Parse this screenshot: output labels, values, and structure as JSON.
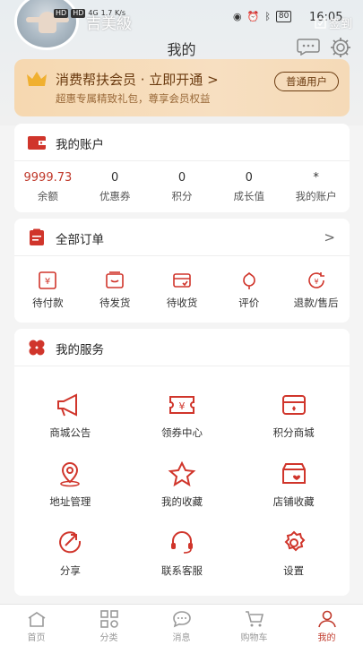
{
  "status_bar": {
    "sim1": "HD",
    "sim2": "HD",
    "net": "4G",
    "speed": "1.7 K/s",
    "battery": "80",
    "time": "16:05"
  },
  "header": {
    "username": "吉美級",
    "signin": "签到",
    "title": "我的"
  },
  "vip": {
    "title": "消费帮扶会员 · 立即开通 >",
    "subtitle": "超惠专属精致礼包，尊享会员权益",
    "badge": "普通用户"
  },
  "account": {
    "title": "我的账户",
    "items": [
      {
        "value": "9999.73",
        "label": "余额"
      },
      {
        "value": "0",
        "label": "优惠券"
      },
      {
        "value": "0",
        "label": "积分"
      },
      {
        "value": "0",
        "label": "成长值"
      },
      {
        "value": "*",
        "label": "我的账户"
      }
    ]
  },
  "orders": {
    "title": "全部订单",
    "arrow": ">",
    "items": [
      {
        "label": "待付款",
        "icon": "wallet-yen-icon"
      },
      {
        "label": "待发货",
        "icon": "box-icon"
      },
      {
        "label": "待收货",
        "icon": "receipt-icon"
      },
      {
        "label": "评价",
        "icon": "flower-icon"
      },
      {
        "label": "退款/售后",
        "icon": "refund-icon"
      }
    ]
  },
  "services": {
    "title": "我的服务",
    "items": [
      {
        "label": "商城公告",
        "icon": "megaphone-icon"
      },
      {
        "label": "领券中心",
        "icon": "coupon-icon"
      },
      {
        "label": "积分商城",
        "icon": "points-mall-icon"
      },
      {
        "label": "地址管理",
        "icon": "location-icon"
      },
      {
        "label": "我的收藏",
        "icon": "star-icon"
      },
      {
        "label": "店铺收藏",
        "icon": "store-heart-icon"
      },
      {
        "label": "分享",
        "icon": "share-icon"
      },
      {
        "label": "联系客服",
        "icon": "headset-icon"
      },
      {
        "label": "设置",
        "icon": "settings-icon"
      }
    ]
  },
  "tabbar": {
    "items": [
      {
        "label": "首页",
        "icon": "home-icon"
      },
      {
        "label": "分类",
        "icon": "category-icon"
      },
      {
        "label": "消息",
        "icon": "message-icon"
      },
      {
        "label": "购物车",
        "icon": "cart-icon"
      },
      {
        "label": "我的",
        "icon": "user-icon"
      }
    ]
  },
  "colors": {
    "accent": "#c0392b",
    "vip_text": "#6b3b10"
  }
}
